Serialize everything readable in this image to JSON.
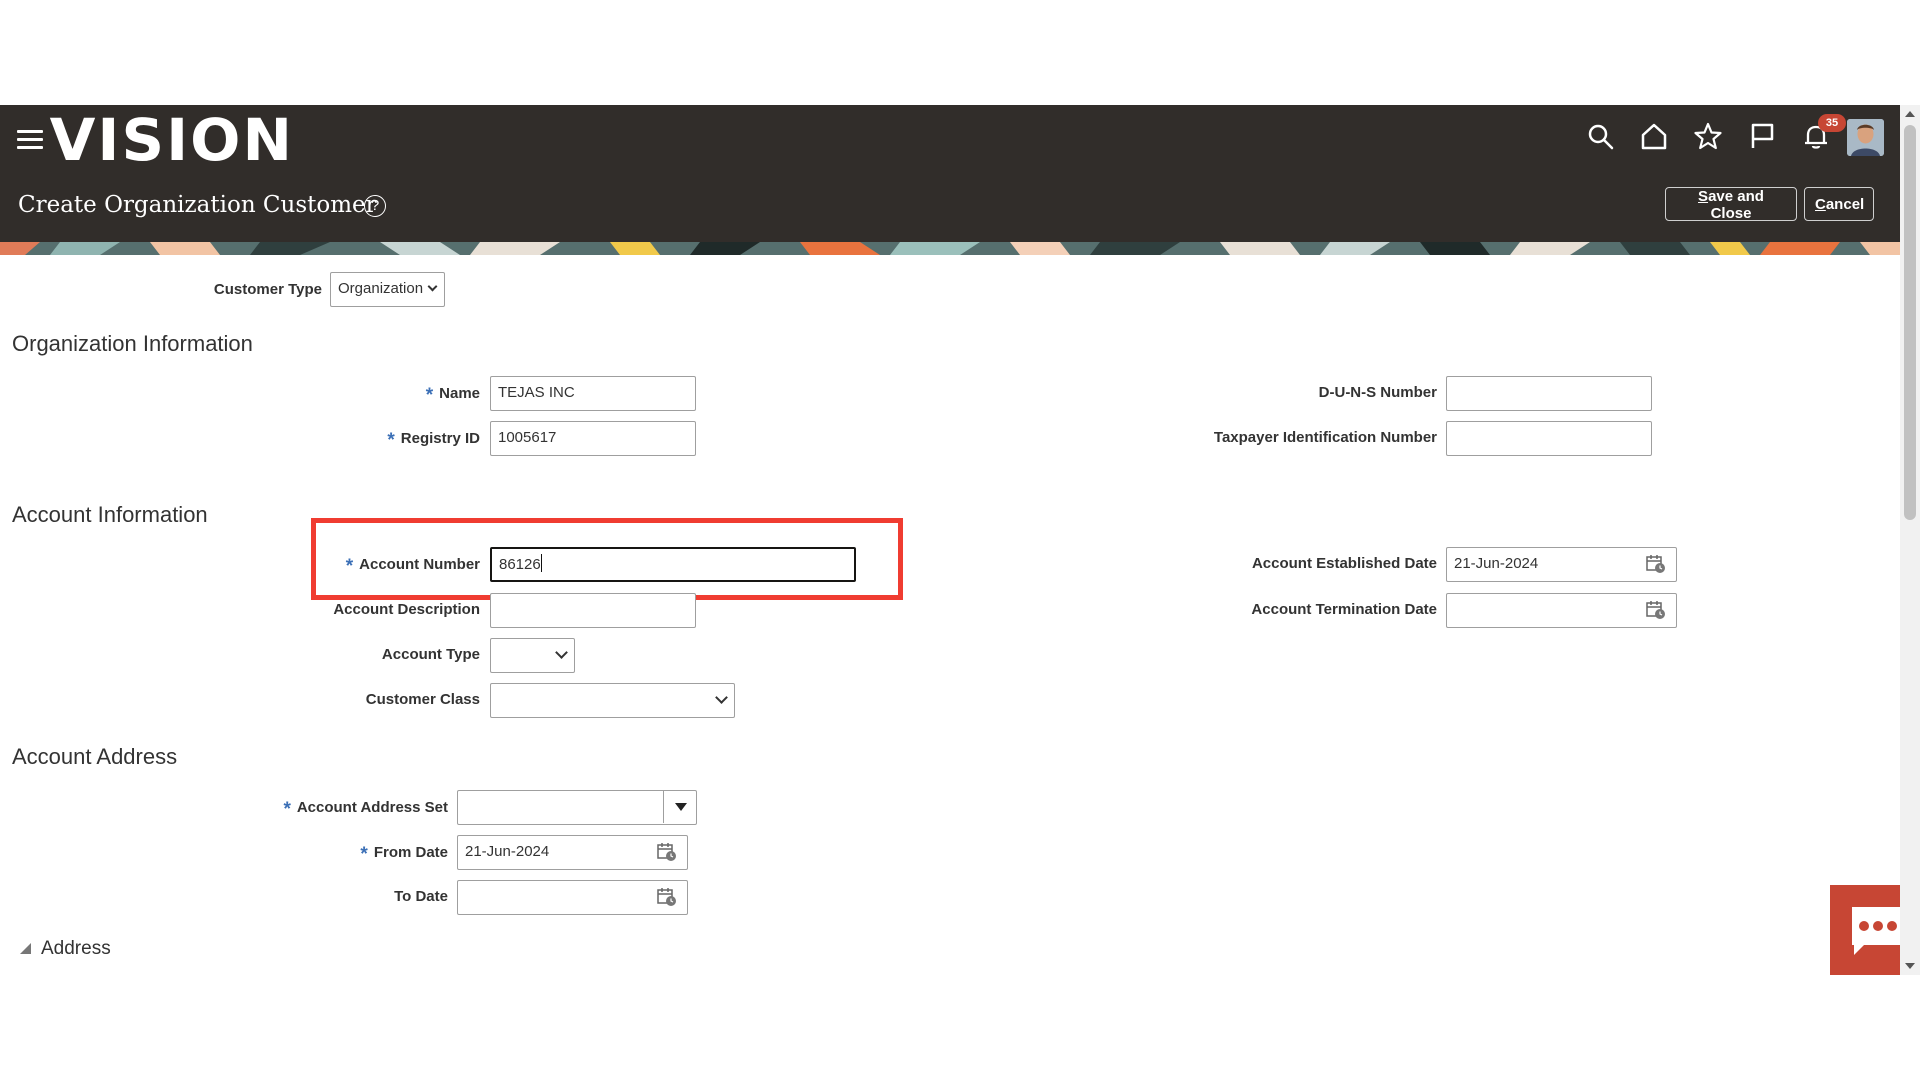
{
  "app": {
    "logo_text": "VISION",
    "page_title": "Create Organization Customer",
    "help_symbol": "?",
    "notification_count": "35",
    "icons": [
      "menu-icon",
      "search-icon",
      "home-icon",
      "star-icon",
      "flag-icon",
      "bell-icon",
      "avatar"
    ]
  },
  "header_buttons": {
    "save_close_first": "S",
    "save_close_rest": "ave and Close",
    "cancel_first": "C",
    "cancel_rest": "ancel"
  },
  "customer_type": {
    "label": "Customer Type",
    "value": "Organization"
  },
  "org_info": {
    "title": "Organization Information",
    "name_label": "Name",
    "name_value": "TEJAS INC",
    "registry_label": "Registry ID",
    "registry_value": "1005617",
    "duns_label": "D-U-N-S Number",
    "duns_value": "",
    "taxpayer_label": "Taxpayer Identification Number",
    "taxpayer_value": ""
  },
  "account_info": {
    "title": "Account Information",
    "number_label": "Account Number",
    "number_value": "86126",
    "description_label": "Account Description",
    "description_value": "",
    "type_label": "Account Type",
    "type_value": "",
    "class_label": "Customer Class",
    "class_value": "",
    "established_label": "Account Established Date",
    "established_value": "21-Jun-2024",
    "termination_label": "Account Termination Date",
    "termination_value": ""
  },
  "account_address": {
    "title": "Account Address",
    "set_label": "Account Address Set",
    "set_value": "",
    "from_label": "From Date",
    "from_value": "21-Jun-2024",
    "to_label": "To Date",
    "to_value": ""
  },
  "address_section": {
    "label": "Address"
  },
  "required_mark": "*",
  "colors": {
    "header_bg": "#312d2a",
    "required": "#3b6fb6",
    "highlight": "#f03c31",
    "badge": "#c74634"
  }
}
